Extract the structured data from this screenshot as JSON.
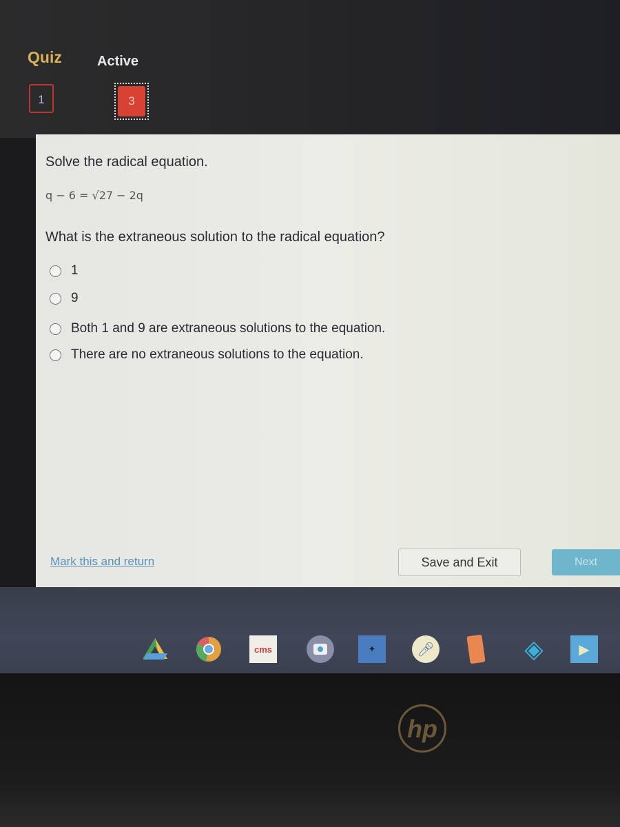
{
  "header": {
    "title": "Quiz",
    "status": "Active"
  },
  "question_nav": [
    {
      "number": "1",
      "state": "answered"
    },
    {
      "number": "3",
      "state": "current"
    }
  ],
  "question": {
    "instruction": "Solve the radical equation.",
    "equation": "q − 6 = √27 − 2q",
    "prompt": "What is the extraneous solution to the radical equation?",
    "options": [
      "1",
      "9",
      "Both 1 and 9 are extraneous solutions to the equation.",
      "There are no extraneous solutions to the equation."
    ]
  },
  "footer": {
    "mark_link": "Mark this and return",
    "save_label": "Save and Exit",
    "next_label": "Next"
  },
  "shelf": {
    "apps": [
      "drive-icon",
      "chrome-icon",
      "cms",
      "camera-icon",
      "dance-app-icon",
      "microphone-icon",
      "orange-app-icon",
      "arrow-app-icon",
      "play-app-icon"
    ],
    "cms_label": "cms"
  },
  "bezel": {
    "logo": "hp"
  },
  "colors": {
    "accent_gold": "#d8b258",
    "current_red": "#d84232",
    "next_blue": "#6fb6cc",
    "link_blue": "#5b92b8"
  }
}
